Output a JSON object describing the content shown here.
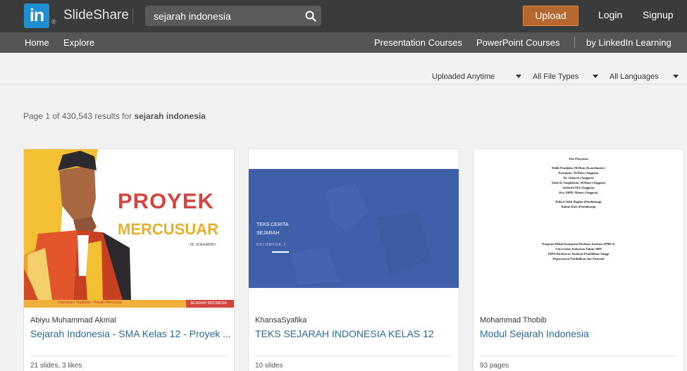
{
  "header": {
    "logo_text": "in",
    "brand": "SlideShare",
    "search_value": "sejarah indonesia",
    "upload_label": "Upload",
    "login_label": "Login",
    "signup_label": "Signup",
    "colors": {
      "topbar": "#3b3b3b",
      "upload": "#b4672e",
      "logo": "#1e8fd0"
    }
  },
  "nav": {
    "home": "Home",
    "explore": "Explore",
    "presentation_courses": "Presentation Courses",
    "powerpoint_courses": "PowerPoint Courses",
    "linkedin_learning": "by LinkedIn Learning"
  },
  "filters": {
    "uploaded": "Uploaded Anytime",
    "file_types": "All File Types",
    "languages": "All Languages"
  },
  "results": {
    "prefix": "Page 1 of 430,543 results for",
    "query": "sejarah indonesia"
  },
  "cards": [
    {
      "author": "Abiyu Muhammad Akmal",
      "title": "Sejarah Indonesia - SMA Kelas 12 - Proyek ...",
      "meta": "21 slides, 3 likes",
      "thumb": {
        "heading1": "PROYEK",
        "heading2": "MERCUSUAR",
        "caption": "- IR. SOEKARNO",
        "footer_left": "Demokrasi Terpimpin - Proyek Mercusuar",
        "footer_right": "SEJARAH INDONESIA"
      }
    },
    {
      "author": "KhansaSyafika",
      "title": "TEKS SEJARAH INDONESIA KELAS 12",
      "meta": "10 slides",
      "thumb": {
        "line1": "TEKS CERITA",
        "line2": "SEJARAH",
        "line3": "KELOMPOK 2"
      }
    },
    {
      "author": "Mohammad Thobib",
      "title": "Modul Sejarah Indonesia",
      "meta": "93 pages",
      "thumb": {
        "team_heading": "Tim Penyusun",
        "members": [
          "Didik Pradjoko, M.Hum (Koordinator)",
          "Kasijanto, M.Hum (Anggota)",
          "Dr. Suharto (Anggota)",
          "Yuda B. Tangkilisan, M.Hum (Anggota)",
          "Sudarini MA (Anggota)",
          "Dra. MPB. Manus (Anggota)"
        ],
        "members2": [
          "Rahyu Sukh Haghia (Pendukung)",
          "Rahmi Rari (Pendukung)"
        ],
        "program": [
          "Program Hibah Kompetisi Berbasis Institusi (PHK-I)",
          "Universitas Indonesia Tahun 2008",
          "DIPA Direktorat Jenderal Pendidikan Tinggi",
          "Departemen Pendidikan dan Nasional"
        ]
      }
    }
  ]
}
